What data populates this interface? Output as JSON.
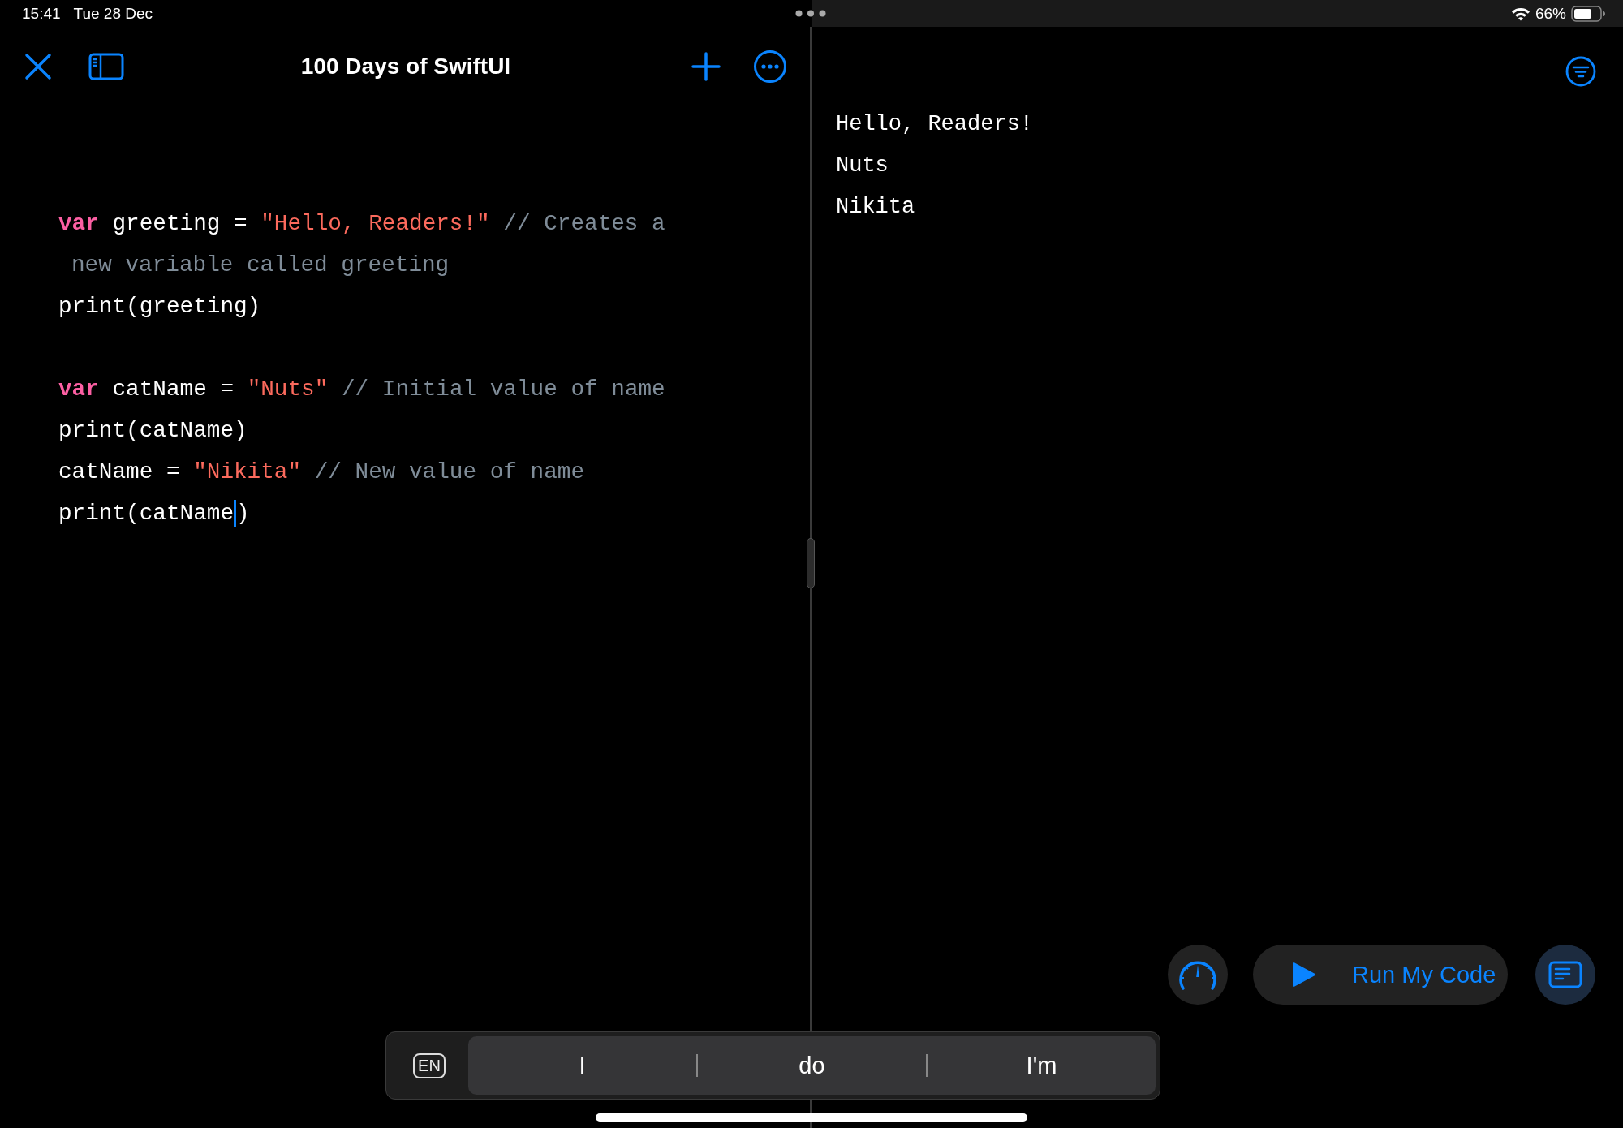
{
  "status_bar": {
    "time": "15:41",
    "date": "Tue 28 Dec",
    "battery_percent": "66%"
  },
  "editor": {
    "title": "100 Days of SwiftUI",
    "lines": [
      {
        "kind": "code",
        "tokens": [
          {
            "kind": "keyword",
            "text": "var"
          },
          {
            "kind": "plain",
            "text": " greeting = "
          },
          {
            "kind": "string",
            "text": "\"Hello, Readers!\""
          },
          {
            "kind": "comment",
            "text": " // Creates a"
          }
        ]
      },
      {
        "kind": "continuation",
        "tokens": [
          {
            "kind": "comment",
            "text": "new variable called greeting"
          }
        ]
      },
      {
        "kind": "code",
        "tokens": [
          {
            "kind": "plain",
            "text": "print(greeting)"
          }
        ]
      },
      {
        "kind": "blank"
      },
      {
        "kind": "code",
        "tokens": [
          {
            "kind": "keyword",
            "text": "var"
          },
          {
            "kind": "plain",
            "text": " catName = "
          },
          {
            "kind": "string",
            "text": "\"Nuts\""
          },
          {
            "kind": "comment",
            "text": " // Initial value of name"
          }
        ]
      },
      {
        "kind": "code",
        "tokens": [
          {
            "kind": "plain",
            "text": "print(catName)"
          }
        ]
      },
      {
        "kind": "code",
        "tokens": [
          {
            "kind": "plain",
            "text": "catName = "
          },
          {
            "kind": "string",
            "text": "\"Nikita\""
          },
          {
            "kind": "comment",
            "text": " // New value of name"
          }
        ]
      },
      {
        "kind": "code",
        "tokens": [
          {
            "kind": "plain",
            "text": "print(catName"
          },
          {
            "kind": "cursor"
          },
          {
            "kind": "plain",
            "text": ")"
          }
        ]
      }
    ]
  },
  "output": {
    "lines": [
      "Hello, Readers!",
      "Nuts",
      "Nikita"
    ]
  },
  "run_button": {
    "label": "Run My Code"
  },
  "keyboard_bar": {
    "language": "EN",
    "suggestions": [
      "I",
      "do",
      "I'm"
    ]
  }
}
